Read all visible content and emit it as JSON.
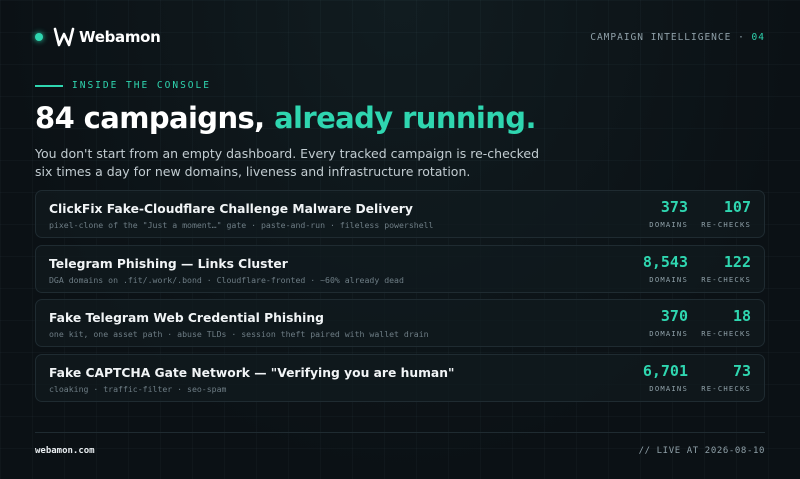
{
  "brand": {
    "name": "Webamon"
  },
  "header": {
    "section_label": "CAMPAIGN INTELLIGENCE",
    "separator": "·",
    "section_number": "04"
  },
  "eyebrow": "INSIDE THE CONSOLE",
  "headline": {
    "prefix": "84 campaigns, ",
    "accent": "already running."
  },
  "subtext": "You don't start from an empty dashboard. Every tracked campaign is re-checked six times a day for new domains, liveness and infrastructure rotation.",
  "stat_labels": {
    "domains": "DOMAINS",
    "rechecks": "RE-CHECKS"
  },
  "campaigns": [
    {
      "title": "ClickFix Fake-Cloudflare Challenge Malware Delivery",
      "tags": "pixel-clone of the \"Just a moment…\" gate · paste-and-run · fileless powershell",
      "domains": "373",
      "rechecks": "107"
    },
    {
      "title": "Telegram Phishing — Links Cluster",
      "tags": "DGA domains on .fit/.work/.bond · Cloudflare-fronted · ~60% already dead",
      "domains": "8,543",
      "rechecks": "122"
    },
    {
      "title": "Fake Telegram Web Credential Phishing",
      "tags": "one kit, one asset path · abuse TLDs · session theft paired with wallet drain",
      "domains": "370",
      "rechecks": "18"
    },
    {
      "title": "Fake CAPTCHA Gate Network — \"Verifying you are human\"",
      "tags": "cloaking · traffic-filter · seo-spam",
      "domains": "6,701",
      "rechecks": "73"
    }
  ],
  "footer": {
    "site": "webamon.com",
    "status": "// LIVE AT 2026-08-10"
  },
  "colors": {
    "accent": "#2fd6b0",
    "background": "#0b1115",
    "card_border": "#1f2b31"
  }
}
